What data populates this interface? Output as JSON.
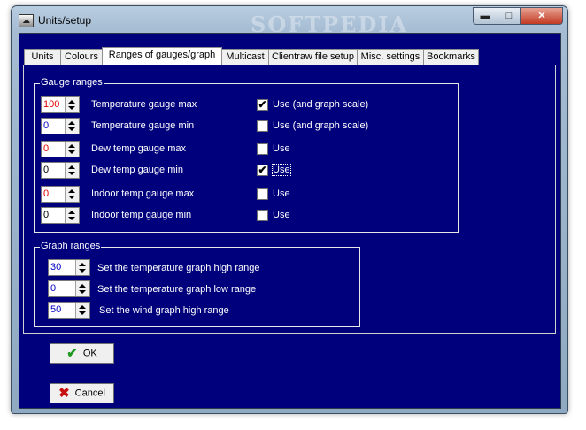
{
  "window": {
    "title": "Units/setup",
    "watermark": "SOFTPEDIA"
  },
  "title_buttons": {
    "minimize": "▬",
    "maximize": "□",
    "close": "✕"
  },
  "tabs": [
    {
      "label": "Units"
    },
    {
      "label": "Colours"
    },
    {
      "label": "Ranges of gauges/graph"
    },
    {
      "label": "Multicast"
    },
    {
      "label": "Clientraw file setup"
    },
    {
      "label": "Misc. settings"
    },
    {
      "label": "Bookmarks"
    }
  ],
  "gauge_ranges": {
    "label": "Gauge ranges",
    "rows": [
      {
        "value": "100",
        "label": "Temperature gauge max",
        "checkbox_label": "Use (and graph scale)",
        "checked": true
      },
      {
        "value": "0",
        "label": "Temperature gauge min",
        "checkbox_label": "Use (and graph scale)",
        "checked": false
      },
      {
        "value": "0",
        "label": "Dew temp gauge max",
        "checkbox_label": "Use",
        "checked": false
      },
      {
        "value": "0",
        "label": "Dew temp gauge min",
        "checkbox_label": "Use",
        "checked": true
      },
      {
        "value": "0",
        "label": "Indoor temp gauge max",
        "checkbox_label": "Use",
        "checked": false
      },
      {
        "value": "0",
        "label": "Indoor temp gauge min",
        "checkbox_label": "Use",
        "checked": false
      }
    ]
  },
  "graph_ranges": {
    "label": "Graph ranges",
    "rows": [
      {
        "value": "30",
        "label": "Set the temperature graph high range"
      },
      {
        "value": "0",
        "label": "Set the temperature graph low range"
      },
      {
        "value": "50",
        "label": "Set the wind graph high range"
      }
    ]
  },
  "buttons": {
    "ok": "OK",
    "cancel": "Cancel"
  },
  "icons": {
    "ok": "checkmark-icon",
    "cancel": "x-icon",
    "app": "app-icon"
  },
  "colors": {
    "client_bg": "#00007d",
    "max_value": "#e00000",
    "min_value": "#0000c0"
  }
}
